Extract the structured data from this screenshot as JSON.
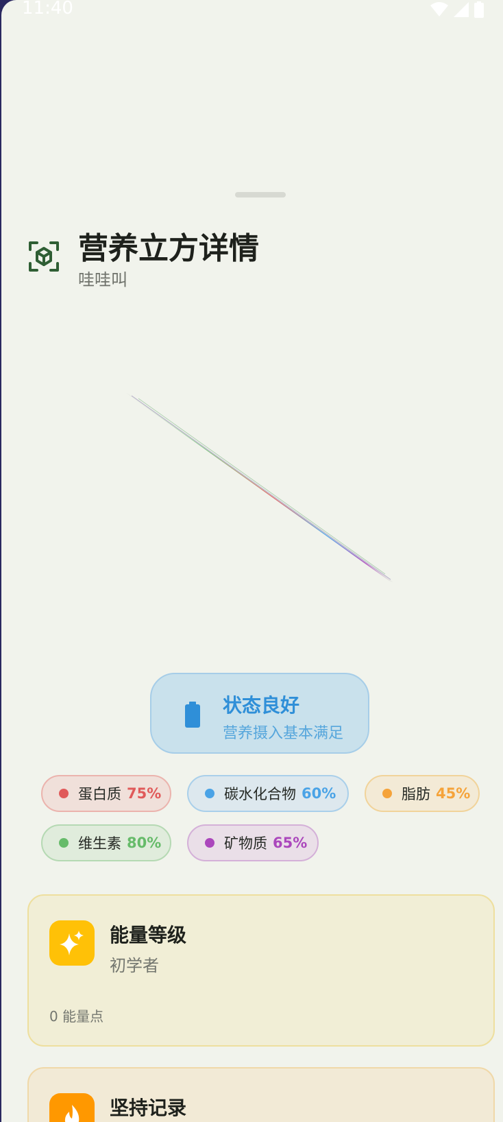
{
  "status_bar": {
    "time": "11:40"
  },
  "header": {
    "title": "营养立方详情",
    "subtitle": "哇哇叫",
    "icon": "cube-scan-icon"
  },
  "status_card": {
    "title": "状态良好",
    "description": "营养摄入基本满足",
    "icon": "battery-icon",
    "accent": "#2f8fd8"
  },
  "nutrients": [
    {
      "label": "蛋白质",
      "percent": "75%",
      "color": "#e05a5a"
    },
    {
      "label": "碳水化合物",
      "percent": "60%",
      "color": "#4aa3e6"
    },
    {
      "label": "脂肪",
      "percent": "45%",
      "color": "#f5a33a"
    },
    {
      "label": "维生素",
      "percent": "80%",
      "color": "#66bb6a"
    },
    {
      "label": "矿物质",
      "percent": "65%",
      "color": "#ab47bc"
    }
  ],
  "energy_card": {
    "title": "能量等级",
    "level": "初学者",
    "points": "0 能量点",
    "icon": "sparkle-icon",
    "accent": "#ffc107"
  },
  "streak_card": {
    "title": "坚持记录",
    "icon": "flame-icon",
    "accent": "#ff9800"
  }
}
